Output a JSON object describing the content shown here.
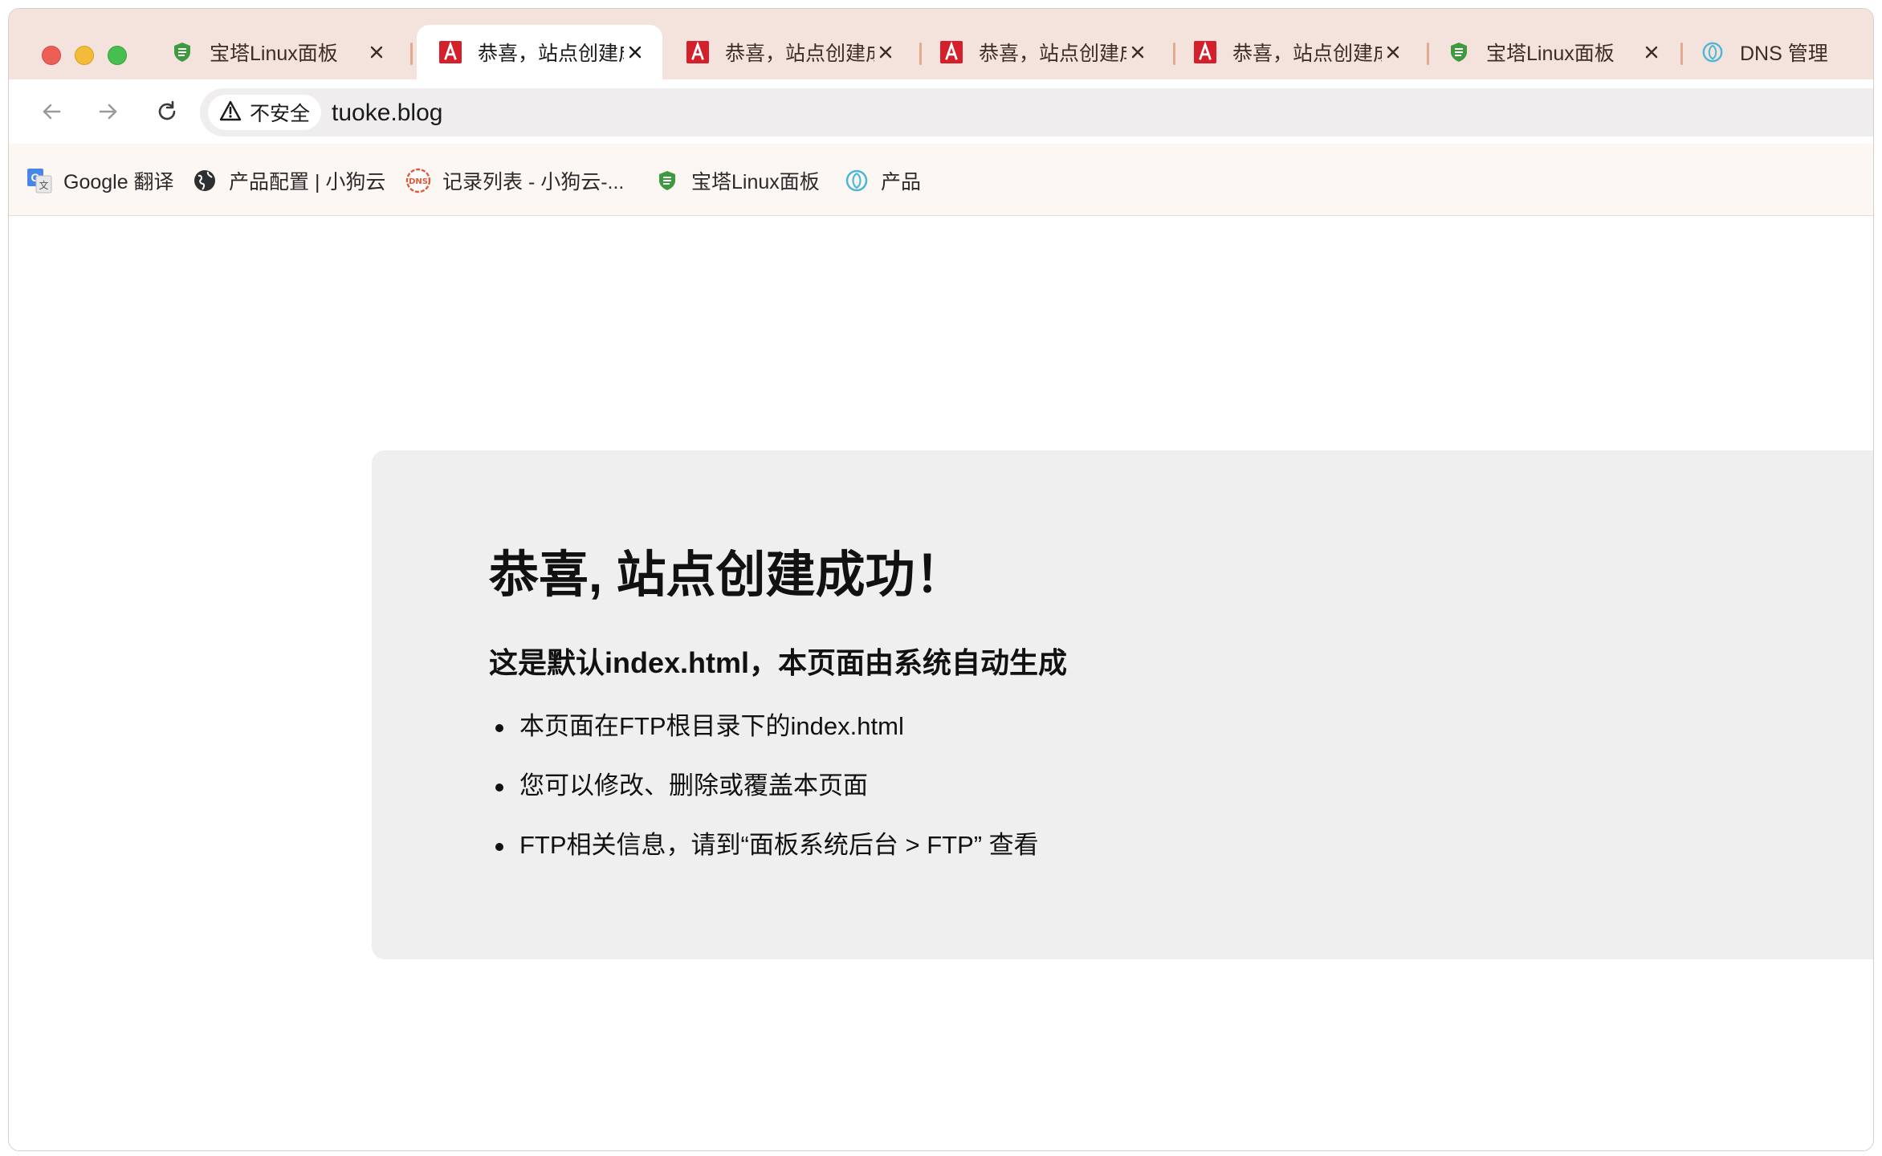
{
  "colors": {
    "titlebar_bg": "#f4e3dc",
    "bookmark_bar_bg": "#fdf7f4",
    "omnibox_bg": "#efeded",
    "panel_bg": "#efefef",
    "bt_green": "#3f9a3f",
    "angular_red": "#d3202b"
  },
  "tabs": [
    {
      "title": "宝塔Linux面板",
      "icon": "baota-shield-icon",
      "active": false
    },
    {
      "title": "恭喜，站点创建成功！",
      "icon": "angular-logo-icon",
      "active": true
    },
    {
      "title": "恭喜，站点创建成功！",
      "icon": "angular-logo-icon",
      "active": false
    },
    {
      "title": "恭喜，站点创建成功！",
      "icon": "angular-logo-icon",
      "active": false
    },
    {
      "title": "恭喜，站点创建成功！",
      "icon": "angular-logo-icon",
      "active": false
    },
    {
      "title": "宝塔Linux面板",
      "icon": "baota-shield-icon",
      "active": false
    },
    {
      "title": "DNS 管理",
      "icon": "cloud-swirl-icon",
      "active": false
    }
  ],
  "toolbar": {
    "security_label": "不安全",
    "url": "tuoke.blog"
  },
  "bookmarks": [
    {
      "label": "Google 翻译",
      "icon": "google-translate-icon"
    },
    {
      "label": "产品配置 | 小狗云",
      "icon": "globe-icon"
    },
    {
      "label": "记录列表 - 小狗云-...",
      "icon": "dns-badge-icon"
    },
    {
      "label": "宝塔Linux面板",
      "icon": "baota-shield-icon"
    },
    {
      "label": "产品",
      "icon": "cloud-swirl-icon"
    }
  ],
  "page": {
    "heading": "恭喜, 站点创建成功！",
    "subheading": "这是默认index.html，本页面由系统自动生成",
    "bullets": [
      "本页面在FTP根目录下的index.html",
      "您可以修改、删除或覆盖本页面",
      "FTP相关信息，请到“面板系统后台 > FTP” 查看"
    ]
  }
}
